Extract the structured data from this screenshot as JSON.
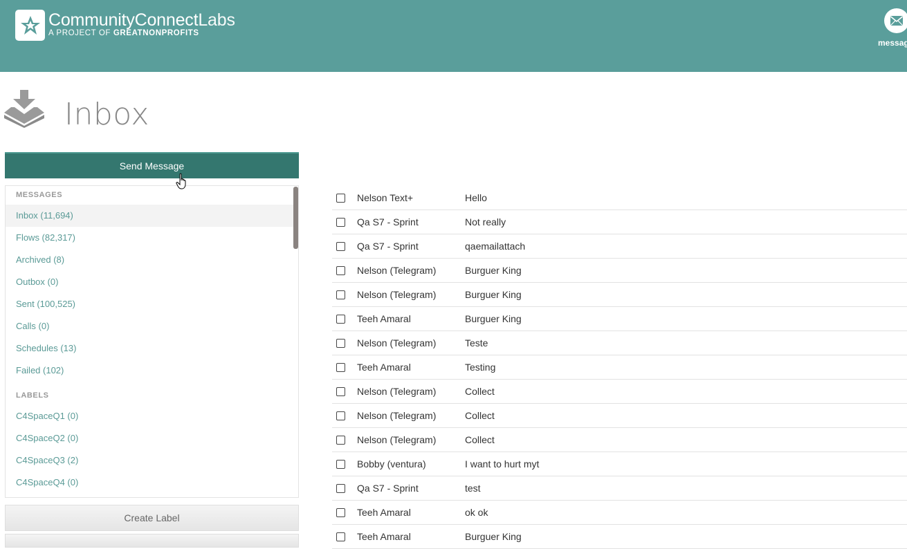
{
  "header": {
    "brand_title": "CommunityConnect",
    "brand_suffix": "Labs",
    "brand_sub_prefix": "A PROJECT OF ",
    "brand_sub_org": "GREATNONPROFITS",
    "message_label": "messag"
  },
  "page": {
    "title": "Inbox",
    "send_button": "Send Message",
    "create_label_button": "Create Label"
  },
  "sidebar": {
    "messages_heading": "MESSAGES",
    "messages": [
      {
        "label": "Inbox (11,694)"
      },
      {
        "label": "Flows (82,317)"
      },
      {
        "label": "Archived (8)"
      },
      {
        "label": "Outbox (0)"
      },
      {
        "label": "Sent (100,525)"
      },
      {
        "label": "Calls (0)"
      },
      {
        "label": "Schedules (13)"
      },
      {
        "label": "Failed (102)"
      }
    ],
    "labels_heading": "LABELS",
    "labels": [
      {
        "label": "C4SpaceQ1 (0)"
      },
      {
        "label": "C4SpaceQ2 (0)"
      },
      {
        "label": "C4SpaceQ3 (2)"
      },
      {
        "label": "C4SpaceQ4 (0)"
      }
    ]
  },
  "messages": [
    {
      "from": "Nelson Text+",
      "text": "Hello"
    },
    {
      "from": "Qa S7 - Sprint",
      "text": "Not really"
    },
    {
      "from": "Qa S7 - Sprint",
      "text": "qaemailattach"
    },
    {
      "from": "Nelson (Telegram)",
      "text": "Burguer King"
    },
    {
      "from": "Nelson (Telegram)",
      "text": "Burguer King"
    },
    {
      "from": "Teeh Amaral",
      "text": "Burguer King"
    },
    {
      "from": "Nelson (Telegram)",
      "text": "Teste"
    },
    {
      "from": "Teeh Amaral",
      "text": "Testing"
    },
    {
      "from": "Nelson (Telegram)",
      "text": "Collect"
    },
    {
      "from": "Nelson (Telegram)",
      "text": "Collect"
    },
    {
      "from": "Nelson (Telegram)",
      "text": "Collect"
    },
    {
      "from": "Bobby (ventura)",
      "text": "I want to hurt myt"
    },
    {
      "from": "Qa S7 - Sprint",
      "text": "test"
    },
    {
      "from": "Teeh Amaral",
      "text": "ok ok"
    },
    {
      "from": "Teeh Amaral",
      "text": "Burguer King"
    }
  ],
  "colors": {
    "header_bg": "#5a9e9b",
    "primary_button": "#34776f",
    "link": "#5a9a96"
  }
}
